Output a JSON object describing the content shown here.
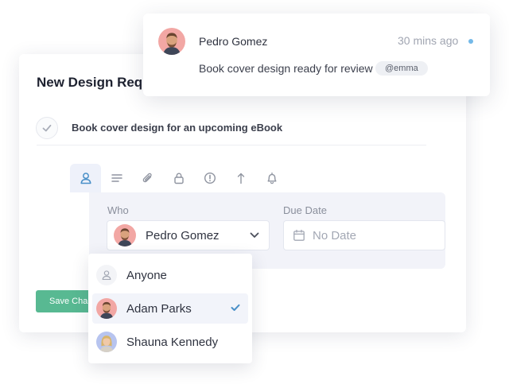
{
  "task": {
    "title": "New Design Req",
    "description": "Book cover design for an upcoming eBook"
  },
  "toolbar": {
    "tabs": [
      {
        "icon": "person-icon",
        "active": true
      },
      {
        "icon": "lines-icon",
        "active": false
      },
      {
        "icon": "paperclip-icon",
        "active": false
      },
      {
        "icon": "lock-icon",
        "active": false
      },
      {
        "icon": "alert-icon",
        "active": false
      },
      {
        "icon": "arrow-up-icon",
        "active": false
      },
      {
        "icon": "bell-icon",
        "active": false
      }
    ]
  },
  "form": {
    "who_label": "Who",
    "due_label": "Due Date",
    "who_selected": "Pedro Gomez",
    "due_placeholder": "No Date"
  },
  "save_button": "Save Chan",
  "dropdown": {
    "items": [
      {
        "label": "Anyone",
        "icon": "person-icon",
        "selected": false
      },
      {
        "label": "Adam Parks",
        "icon": "avatar",
        "selected": true
      },
      {
        "label": "Shauna Kennedy",
        "icon": "avatar",
        "selected": false
      }
    ]
  },
  "notification": {
    "name": "Pedro Gomez",
    "time": "30 mins ago",
    "message": "Book cover design ready for review",
    "mention": "@emma"
  },
  "colors": {
    "accent_blue": "#4a90c8",
    "save_green": "#58b992",
    "unread_dot": "#74b9e8"
  }
}
